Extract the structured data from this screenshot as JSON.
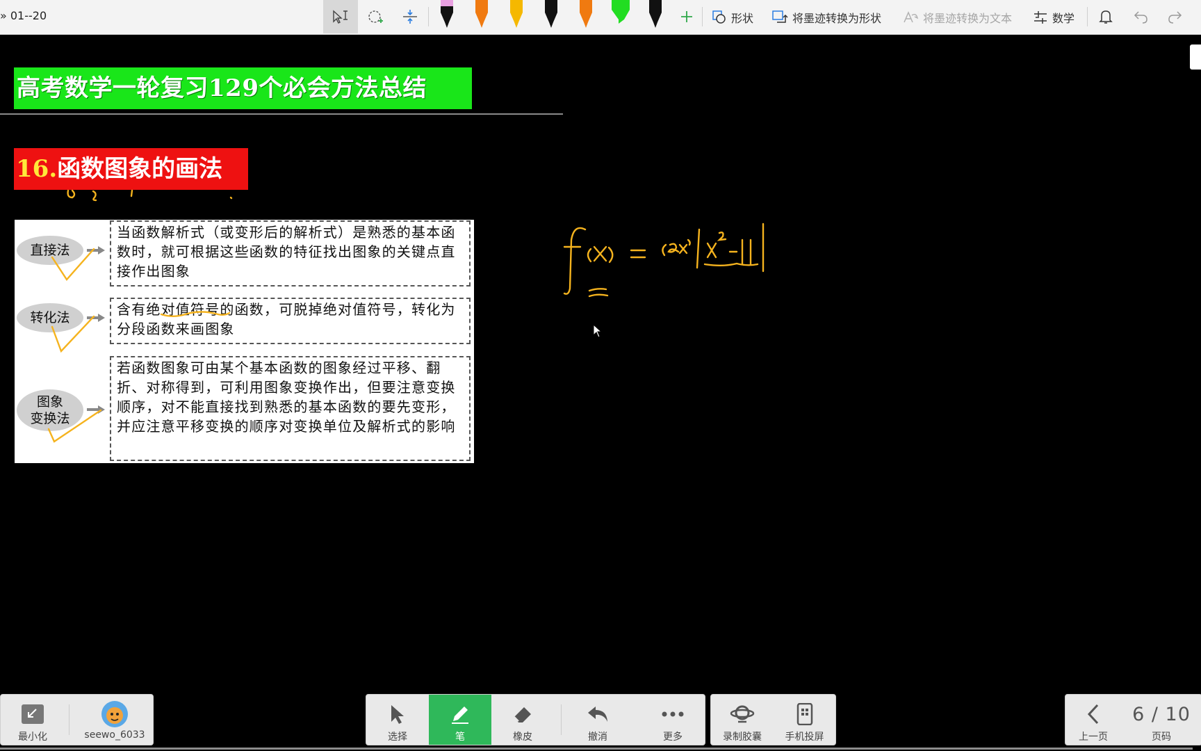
{
  "toolbar": {
    "breadcrumb": "» 01--20",
    "shape_label": "形状",
    "ink_to_shape_label": "将墨迹转换为形状",
    "ink_to_text_label": "将墨迹转换为文本",
    "math_label": "数学",
    "pens": [
      {
        "name": "pen-black-pink",
        "color": "#111111",
        "cap": "#e8a0e0"
      },
      {
        "name": "pen-orange",
        "color": "#f07a10",
        "cap": "#f07a10"
      },
      {
        "name": "pen-yellow",
        "color": "#f5b800",
        "cap": "#f5b800"
      },
      {
        "name": "pen-black",
        "color": "#111111",
        "cap": "#111111"
      },
      {
        "name": "pen-orange-marker",
        "color": "#f07a10",
        "cap": "#f07a10"
      },
      {
        "name": "highlighter-green",
        "color": "#22dd22",
        "cap": "#22dd22"
      },
      {
        "name": "pen-black-2",
        "color": "#111111",
        "cap": "#111111"
      }
    ]
  },
  "slide": {
    "title": "高考数学一轮复习129个必会方法总结",
    "section_number": "16.",
    "section_title": "函数图象的画法",
    "methods": [
      {
        "name": "直接法",
        "desc": "当函数解析式（或变形后的解析式）是熟悉的基本函数时，就可根据这些函数的特征找出图象的关键点直接作出图象"
      },
      {
        "name": "转化法",
        "desc": "含有绝对值符号的函数，可脱掉绝对值符号，转化为分段函数来画图象"
      },
      {
        "name_line1": "图象",
        "name_line2": "变换法",
        "desc": "若函数图象可由某个基本函数的图象经过平移、翻折、对称得到，可利用图象变换作出，但要注意变换顺序，对不能直接找到熟悉的基本函数的要先变形，并应注意平移变换的顺序对变换单位及解析式的影响"
      }
    ]
  },
  "bottom": {
    "minimize_label": "最小化",
    "user_label": "seewo_6033",
    "select_label": "选择",
    "pen_label": "笔",
    "eraser_label": "橡皮",
    "undo_label": "撤消",
    "more_label": "更多",
    "record_label": "录制胶囊",
    "cast_label": "手机投屏",
    "prev_label": "上一页",
    "page_label": "页码",
    "page_indicator": "6 / 10"
  },
  "colors": {
    "ink": "#f5b31e",
    "active_green": "#2fb85a",
    "title_green": "#19e619",
    "section_red": "#ee1111"
  }
}
